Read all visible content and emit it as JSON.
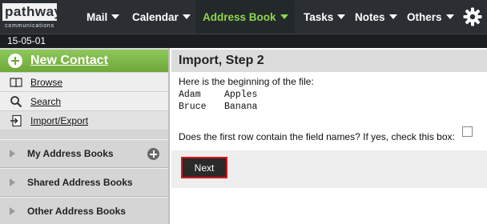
{
  "logo": {
    "word": "pathway",
    "subtitle": "communications"
  },
  "nav": {
    "mail": "Mail",
    "calendar": "Calendar",
    "address_book": "Address Book",
    "tasks": "Tasks",
    "notes": "Notes",
    "others": "Others",
    "settings_icon": "gear-icon",
    "active_color": "#8fd64b"
  },
  "date": "15-05-01",
  "sidebar": {
    "new_contact": "New Contact",
    "items": [
      {
        "label": "Browse",
        "icon": "book-icon"
      },
      {
        "label": "Search",
        "icon": "search-icon"
      },
      {
        "label": "Import/Export",
        "icon": "import-export-icon"
      }
    ],
    "sections": [
      {
        "label": "My Address Books"
      },
      {
        "label": "Shared Address Books"
      },
      {
        "label": "Other Address Books"
      }
    ],
    "accent_color": "#7cb848"
  },
  "main": {
    "title": "Import, Step 2",
    "intro": "Here is the beginning of the file:",
    "file_rows": [
      [
        "Adam",
        "Apples"
      ],
      [
        "Bruce",
        "Banana"
      ]
    ],
    "question": "Does the first row contain the field names? If yes, check this box:",
    "first_row_header_checked": false,
    "next_label": "Next",
    "next_highlight_color": "#d7141a"
  }
}
